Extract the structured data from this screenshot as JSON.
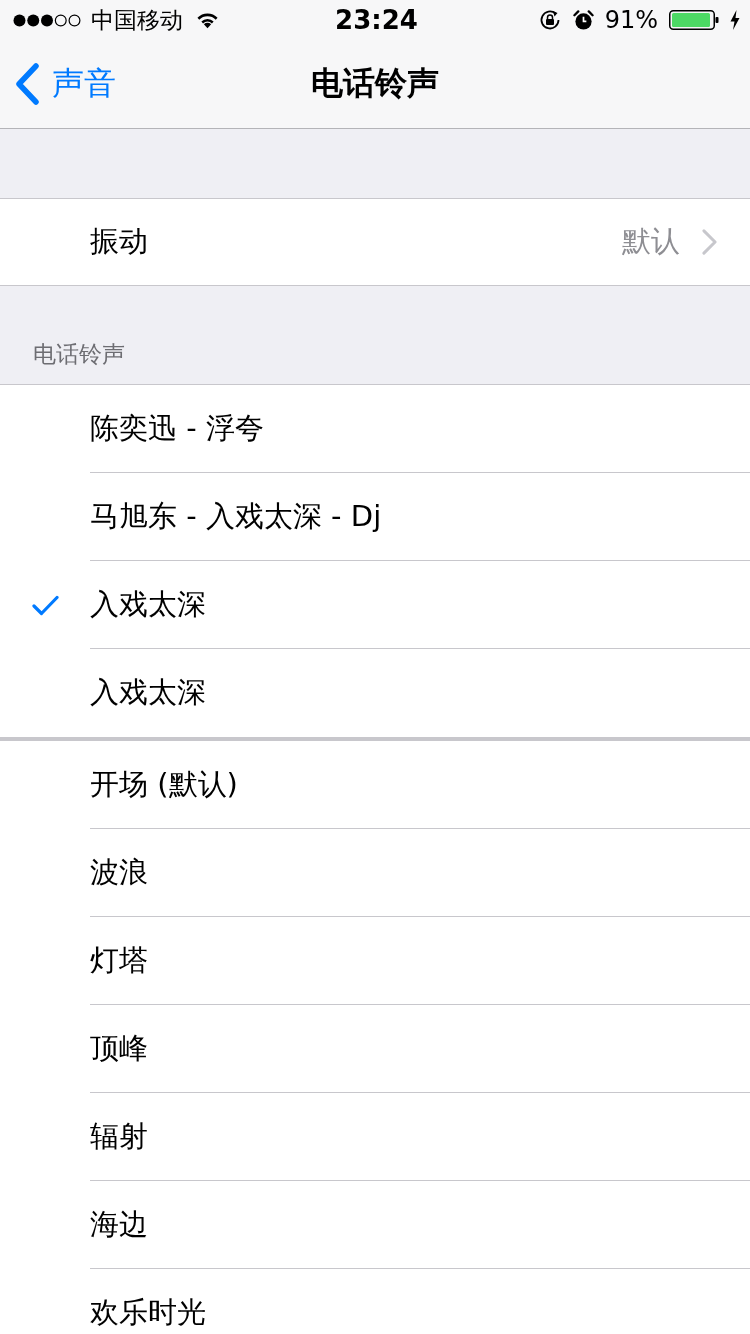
{
  "status_bar": {
    "carrier": "中国移动",
    "time": "23:24",
    "battery": "91%"
  },
  "nav_bar": {
    "back": "声音",
    "title": "电话铃声"
  },
  "vibration": {
    "label": "振动",
    "value": "默认"
  },
  "section_header": "电话铃声",
  "ringtone_groups": [
    {
      "items": [
        {
          "label": "陈奕迅 - 浮夸",
          "selected": false
        },
        {
          "label": "马旭东 - 入戏太深 - Dj",
          "selected": false
        },
        {
          "label": "入戏太深",
          "selected": true
        },
        {
          "label": "入戏太深",
          "selected": false
        }
      ]
    },
    {
      "items": [
        {
          "label": "开场 (默认)",
          "selected": false
        },
        {
          "label": "波浪",
          "selected": false
        },
        {
          "label": "灯塔",
          "selected": false
        },
        {
          "label": "顶峰",
          "selected": false
        },
        {
          "label": "辐射",
          "selected": false
        },
        {
          "label": "海边",
          "selected": false
        },
        {
          "label": "欢乐时光",
          "selected": false
        }
      ]
    }
  ]
}
